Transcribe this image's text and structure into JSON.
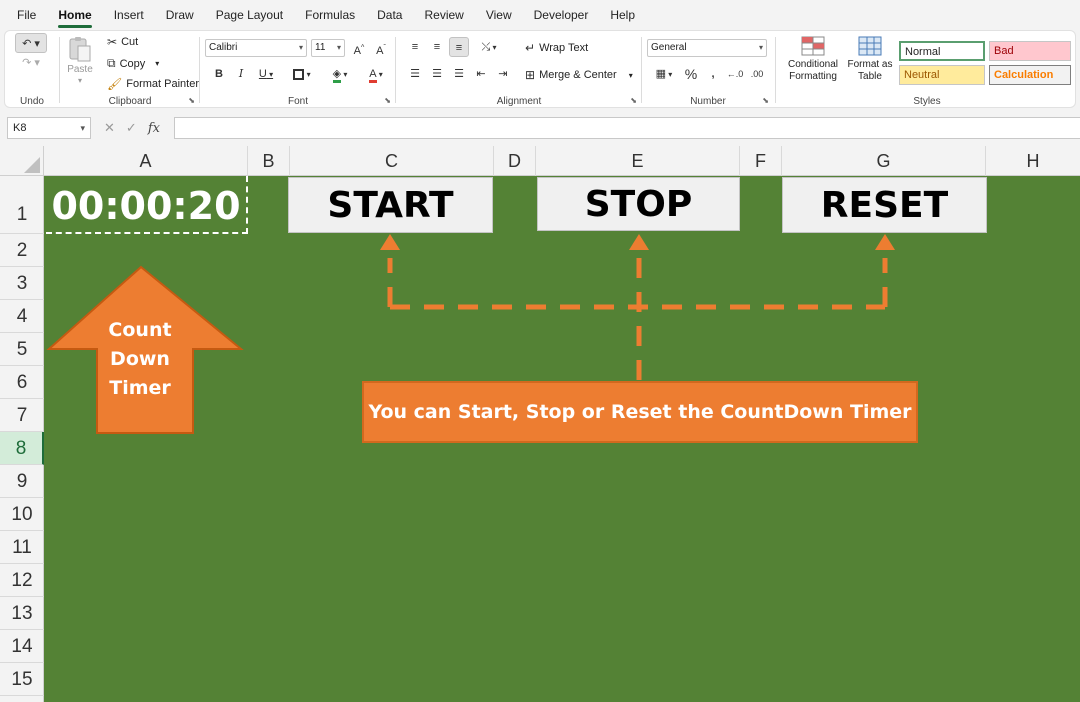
{
  "menu": [
    "File",
    "Home",
    "Insert",
    "Draw",
    "Page Layout",
    "Formulas",
    "Data",
    "Review",
    "View",
    "Developer",
    "Help"
  ],
  "ribbon": {
    "undo_label": "Undo",
    "clipboard": {
      "paste": "Paste",
      "cut": "Cut",
      "copy": "Copy",
      "format_painter": "Format Painter",
      "label": "Clipboard"
    },
    "font": {
      "name": "Calibri",
      "size": "11",
      "label": "Font"
    },
    "alignment": {
      "wrap_text": "Wrap Text",
      "merge_center": "Merge & Center",
      "label": "Alignment"
    },
    "number": {
      "format": "General",
      "label": "Number"
    },
    "styles": {
      "conditional_formatting": "Conditional Formatting",
      "format_as_table": "Format as Table",
      "normal": "Normal",
      "bad": "Bad",
      "neutral": "Neutral",
      "calculation": "Calculation",
      "label": "Styles"
    }
  },
  "formula_bar": {
    "name_box": "K8",
    "fx": "fx",
    "content": ""
  },
  "columns": [
    "A",
    "B",
    "C",
    "D",
    "E",
    "F",
    "G",
    "H"
  ],
  "rows": [
    "1",
    "2",
    "3",
    "4",
    "5",
    "6",
    "7",
    "8",
    "9",
    "10",
    "11",
    "12",
    "13",
    "14",
    "15"
  ],
  "active_row": "8",
  "sheet": {
    "timer": "00:00:20",
    "start": "START",
    "stop": "STOP",
    "reset": "RESET",
    "arrow_label_lines": [
      "Count",
      "Down",
      "Timer"
    ],
    "callout": "You can Start, Stop or Reset the CountDown Timer"
  },
  "colors": {
    "sheet_bg": "#548235",
    "accent_orange": "#ed7d31",
    "excel_green": "#1e6c3a"
  }
}
